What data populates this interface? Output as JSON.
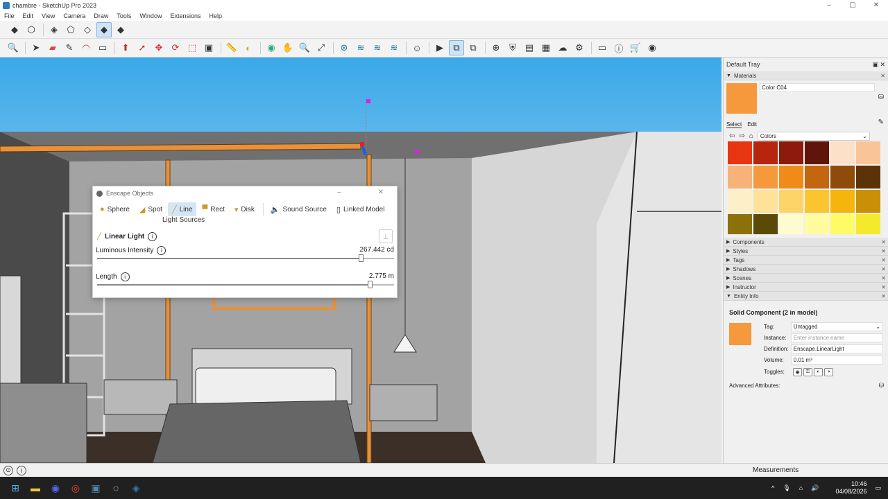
{
  "window": {
    "title": "chambre - SketchUp Pro 2023",
    "min": "–",
    "max": "▢",
    "close": "✕"
  },
  "menu": [
    "File",
    "Edit",
    "View",
    "Camera",
    "Draw",
    "Tools",
    "Window",
    "Extensions",
    "Help"
  ],
  "enscape": {
    "title": "Enscape Objects",
    "tabs": [
      {
        "label": "Sphere",
        "icon": "sphere-icon"
      },
      {
        "label": "Spot",
        "icon": "spot-icon"
      },
      {
        "label": "Line",
        "icon": "line-icon",
        "active": true
      },
      {
        "label": "Rect",
        "icon": "rect-icon"
      },
      {
        "label": "Disk",
        "icon": "disk-icon"
      },
      {
        "label": "Sound Source",
        "icon": "speaker-icon"
      },
      {
        "label": "Linked Model",
        "icon": "linked-model-icon"
      }
    ],
    "group_label": "Light Sources",
    "section": "Linear Light",
    "params": {
      "intensity": {
        "label": "Luminous Intensity",
        "value": "267.442 cd",
        "fraction": 0.89
      },
      "length": {
        "label": "Length",
        "value": "2.775 m",
        "fraction": 0.92
      }
    }
  },
  "tray": {
    "title": "Default Tray",
    "materials": {
      "header": "Materials",
      "name": "Color C04",
      "swatch": "#f5993c",
      "tab_select": "Select",
      "tab_edit": "Edit",
      "library": "Colors",
      "colors": [
        "#e83512",
        "#b7250f",
        "#8c1b0e",
        "#5f1509",
        "#fde0c8",
        "#f9c596",
        "#f7b27a",
        "#f5993c",
        "#f08b1a",
        "#c4660f",
        "#8e4b0a",
        "#5c3308",
        "#fdf0c8",
        "#fde39a",
        "#fdd468",
        "#fbc52f",
        "#f5b50c",
        "#c98f07",
        "#8c7008",
        "#5b4a07",
        "#fffbd0",
        "#fffb9e",
        "#fffb66",
        "#f4ea2b"
      ]
    },
    "sections": [
      "Components",
      "Styles",
      "Tags",
      "Shadows",
      "Scenes",
      "Instructor"
    ],
    "entity": {
      "header": "Entity Info",
      "title": "Solid Component (2 in model)",
      "swatch": "#f5993c",
      "tag_label": "Tag:",
      "tag": "Untagged",
      "instance_label": "Instance:",
      "instance_placeholder": "Enter instance name",
      "definition_label": "Definition:",
      "definition": "Enscape.LinearLight",
      "volume_label": "Volume:",
      "volume": "0.01 m³",
      "toggles_label": "Toggles:",
      "advanced": "Advanced Attributes:"
    }
  },
  "status": {
    "measurements": "Measurements"
  },
  "taskbar": {
    "time": "10:46",
    "date": "04/08/2026"
  }
}
